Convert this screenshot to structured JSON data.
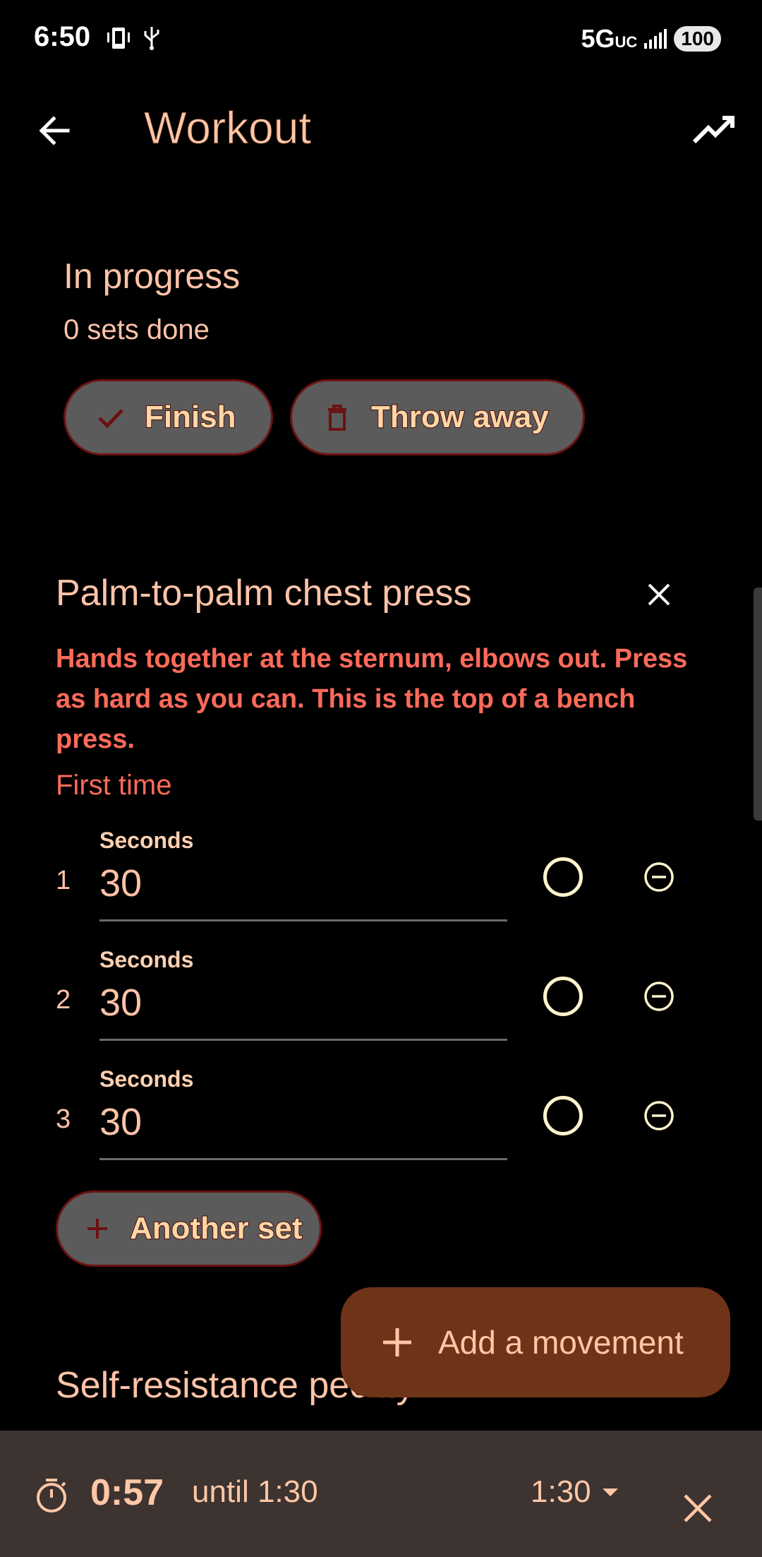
{
  "status_bar": {
    "time": "6:50",
    "network": "5G",
    "network_sub": "UC",
    "battery": "100"
  },
  "header": {
    "title": "Workout",
    "back_icon": "arrow-back-icon",
    "trend_icon": "trending-up-icon"
  },
  "session": {
    "status": "In progress",
    "sets_done": "0 sets done",
    "finish_label": "Finish",
    "throw_away_label": "Throw away"
  },
  "movement": {
    "name": "Palm-to-palm chest press",
    "description": "Hands together at the sternum, elbows out. Press as hard as you can. This is the top of a bench press.",
    "history": "First time",
    "sets": [
      {
        "number": "1",
        "label": "Seconds",
        "value": "30"
      },
      {
        "number": "2",
        "label": "Seconds",
        "value": "30"
      },
      {
        "number": "3",
        "label": "Seconds",
        "value": "30"
      }
    ],
    "another_set_label": "Another set"
  },
  "fab": {
    "label": "Add a movement"
  },
  "next_movement": {
    "name": "Self-resistance pec fly"
  },
  "timer": {
    "elapsed": "0:57",
    "until": "until 1:30",
    "target": "1:30"
  },
  "colors": {
    "accent": "#ffc7a6",
    "description": "#ff6a5a",
    "fab": "#6f3318",
    "timer_bar": "#3d3330",
    "button_bg": "#5b5b5b"
  }
}
